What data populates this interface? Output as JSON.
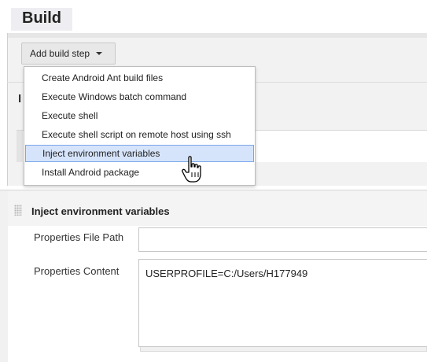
{
  "build": {
    "heading": "Build"
  },
  "add_build_step": {
    "label": "Add build step"
  },
  "dropdown": {
    "items": [
      {
        "label": "Create Android Ant build files"
      },
      {
        "label": "Execute Windows batch command"
      },
      {
        "label": "Execute shell"
      },
      {
        "label": "Execute shell script on remote host using ssh"
      },
      {
        "label": "Inject environment variables",
        "selected": true
      },
      {
        "label": "Install Android package"
      }
    ]
  },
  "behind_text": {
    "letter": "I"
  },
  "inject_section": {
    "title": "Inject environment variables",
    "properties_file_path": {
      "label": "Properties File Path",
      "value": ""
    },
    "properties_content": {
      "label": "Properties Content",
      "value": "USERPROFILE=C:/Users/H177949"
    }
  },
  "colors": {
    "selected_bg": "#d6e4fb",
    "selected_border": "#7aa5ea",
    "heading_bg": "#eeeef2"
  },
  "icons": [
    "caret-down-icon",
    "hand-pointer-icon",
    "drag-handle-icon"
  ]
}
